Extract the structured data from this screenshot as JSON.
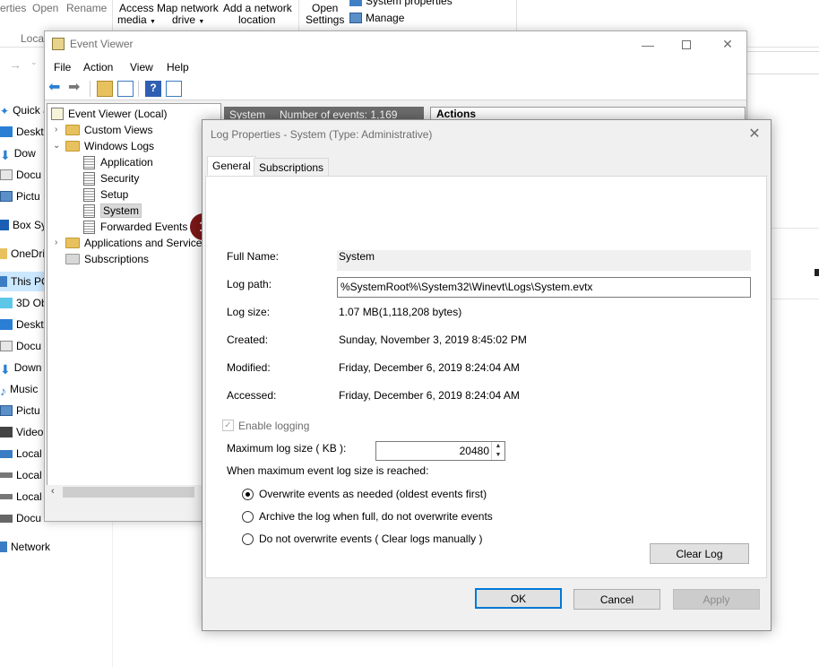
{
  "explorer": {
    "ribbon": {
      "properties": "erties",
      "open": "Open",
      "rename": "Rename",
      "access_media_1": "Access",
      "access_media_2": "media",
      "map_drive_1": "Map network",
      "map_drive_2": "drive",
      "add_location_1": "Add a network",
      "add_location_2": "location",
      "open_settings_1": "Open",
      "open_settings_2": "Settings",
      "system_properties": "System properties",
      "manage": "Manage",
      "location_group": "Locat"
    },
    "nav": [
      "Quick a",
      "Deskt",
      "Dow",
      "Docu",
      "Pictu",
      "Box Sy",
      "OneDri",
      "This PC",
      "3D Ob",
      "Deskt",
      "Docu",
      "Down",
      "Music",
      "Pictu",
      "Video",
      "Local",
      "Local",
      "Local",
      "Docu",
      "Network"
    ]
  },
  "event_viewer": {
    "title": "Event Viewer",
    "menu": [
      "File",
      "Action",
      "View",
      "Help"
    ],
    "tree": {
      "root": "Event Viewer (Local)",
      "custom_views": "Custom Views",
      "windows_logs": "Windows Logs",
      "application": "Application",
      "security": "Security",
      "setup": "Setup",
      "system": "System",
      "forwarded_events": "Forwarded Events",
      "apps_services": "Applications and Services",
      "subscriptions": "Subscriptions"
    },
    "mid_header": {
      "log": "System",
      "count": "Number of events: 1,169"
    },
    "actions_header": "Actions",
    "badge": "1"
  },
  "dialog": {
    "title": "Log Properties - System (Type: Administrative)",
    "tabs": [
      "General",
      "Subscriptions"
    ],
    "fields": {
      "full_name_label": "Full Name:",
      "full_name_value": "System",
      "log_path_label": "Log path:",
      "log_path_value": "%SystemRoot%\\System32\\Winevt\\Logs\\System.evtx",
      "log_size_label": "Log size:",
      "log_size_value": "1.07 MB(1,118,208 bytes)",
      "created_label": "Created:",
      "created_value": "Sunday, November 3, 2019 8:45:02 PM",
      "modified_label": "Modified:",
      "modified_value": "Friday, December 6, 2019 8:24:04 AM",
      "accessed_label": "Accessed:",
      "accessed_value": "Friday, December 6, 2019 8:24:04 AM"
    },
    "enable_logging": "Enable logging",
    "max_size_label": "Maximum log size ( KB ):",
    "max_size_value": "20480",
    "when_max_label": "When maximum event log size is reached:",
    "options": [
      "Overwrite events as needed (oldest events first)",
      "Archive the log when full, do not overwrite events",
      "Do not overwrite events ( Clear logs manually )"
    ],
    "clear_log": "Clear Log",
    "ok": "OK",
    "cancel": "Cancel",
    "apply": "Apply"
  }
}
